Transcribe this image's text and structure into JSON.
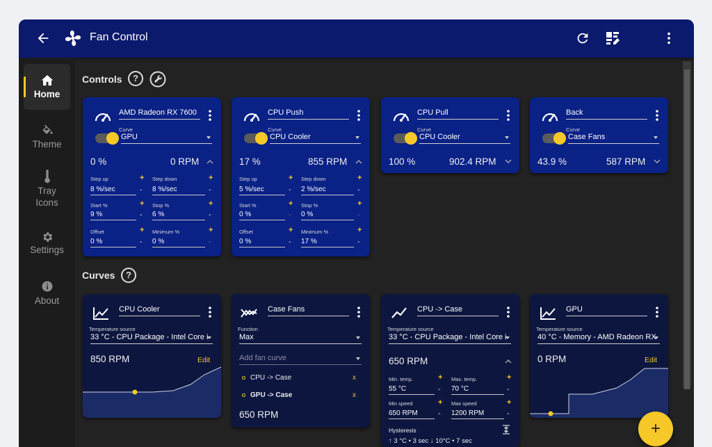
{
  "topbar": {
    "title": "Fan Control",
    "back_icon": "arrow-left-icon",
    "logo_icon": "fan-icon",
    "refresh_icon": "refresh-icon",
    "edit_icon": "edit-list-icon",
    "more_icon": "more-vert-icon"
  },
  "nav": [
    {
      "label": "Home",
      "icon": "home-icon",
      "active": true
    },
    {
      "label": "Theme",
      "icon": "paint-bucket-icon"
    },
    {
      "label": "Tray\nIcons",
      "label1": "Tray",
      "label2": "Icons",
      "icon": "thermometer-icon"
    },
    {
      "label": "Settings",
      "icon": "gear-icon"
    },
    {
      "label": "About",
      "icon": "info-icon"
    }
  ],
  "sections": {
    "controls": "Controls",
    "curves": "Curves",
    "help": "?"
  },
  "controls": [
    {
      "name": "AMD Radeon RX 7600",
      "curve_label": "Curve",
      "curve": "GPU",
      "percent": "0 %",
      "rpm": "0 RPM",
      "expanded": true,
      "fields": {
        "step_up_label": "Step up",
        "step_up": "8 %/sec",
        "step_down_label": "Step down",
        "step_down": "8 %/sec",
        "start_label": "Start %",
        "start": "9 %",
        "stop_label": "Stop %",
        "stop": "6 %",
        "offset_label": "Offset",
        "offset": "0 %",
        "minimum_label": "Minimum %",
        "minimum": "0 %"
      }
    },
    {
      "name": "CPU Push",
      "curve_label": "Curve",
      "curve": "CPU Cooler",
      "percent": "17 %",
      "rpm": "855 RPM",
      "expanded": true,
      "fields": {
        "step_up_label": "Step up",
        "step_up": "5 %/sec",
        "step_down_label": "Step down",
        "step_down": "2 %/sec",
        "start_label": "Start %",
        "start": "0 %",
        "stop_label": "Stop %",
        "stop": "0 %",
        "offset_label": "Offset",
        "offset": "0 %",
        "minimum_label": "Minimum %",
        "minimum": "17 %"
      }
    },
    {
      "name": "CPU Pull",
      "curve_label": "Curve",
      "curve": "CPU Cooler",
      "percent": "100 %",
      "rpm": "902.4 RPM",
      "expanded": false
    },
    {
      "name": "Back",
      "curve_label": "Curve",
      "curve": "Case Fans",
      "percent": "43.9 %",
      "rpm": "587 RPM",
      "expanded": false
    }
  ],
  "curves": [
    {
      "name": "CPU Cooler",
      "source_label": "Temperature source",
      "source": "33 °C - CPU Package - Intel Core i",
      "rpm": "850 RPM",
      "edit": "Edit",
      "icon": "line-chart-icon"
    },
    {
      "name": "Case Fans",
      "function_label": "Function",
      "function": "Max",
      "add_placeholder": "Add fan curve",
      "items": [
        "CPU -> Case",
        "GPU -> Case"
      ],
      "remove": "x",
      "rpm": "650 RPM",
      "icon": "mix-curve-icon"
    },
    {
      "name": "CPU -> Case",
      "source_label": "Temperature source",
      "source": "33 °C - CPU Package - Intel Core i",
      "rpm": "650 RPM",
      "min_temp_label": "Min. temp.",
      "min_temp": "55 °C",
      "max_temp_label": "Max. temp.",
      "max_temp": "70 °C",
      "min_speed_label": "Min speed",
      "min_speed": "650 RPM",
      "max_speed_label": "Max speed",
      "max_speed": "1200 RPM",
      "hysteresis_label": "Hysteresis",
      "hysteresis": "↑ 3 °C • 3 sec  ↓ 10°C • 7 sec",
      "icon": "trend-line-icon"
    },
    {
      "name": "GPU",
      "source_label": "Temperature source",
      "source": "40 °C - Memory - AMD Radeon RX",
      "rpm": "0 RPM",
      "edit": "Edit",
      "icon": "line-chart-icon"
    }
  ],
  "fab": {
    "label": "+",
    "icon": "add-icon"
  },
  "colors": {
    "accent": "#f7c829",
    "card": "#0a2186",
    "card_dark": "#0c163f",
    "topbar": "#0b1a6d"
  }
}
